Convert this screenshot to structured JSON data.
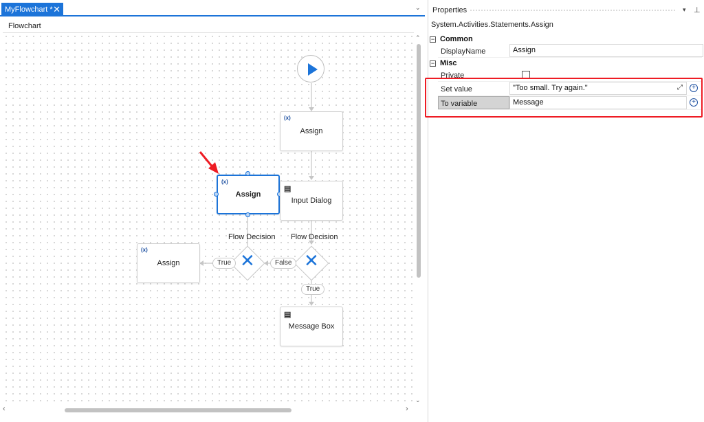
{
  "tab": {
    "title": "MyFlowchart *",
    "close": "✕",
    "dropdown": "⌄"
  },
  "breadcrumb": "Flowchart",
  "flowchart": {
    "assign_top": "Assign",
    "assign_selected": "Assign",
    "assign_left": "Assign",
    "input_dialog": "Input Dialog",
    "message_box": "Message Box",
    "decision_left": "Flow Decision",
    "decision_right": "Flow Decision",
    "pill_true_left": "True",
    "pill_false": "False",
    "pill_true_bottom": "True",
    "assign_icon": "(x)",
    "dialog_icon": "▤"
  },
  "properties": {
    "title": "Properties",
    "type": "System.Activities.Statements.Assign",
    "categories": {
      "common": "Common",
      "misc": "Misc",
      "collapse_glyph": "−"
    },
    "rows": {
      "display_name": {
        "label": "DisplayName",
        "value": "Assign"
      },
      "private": {
        "label": "Private",
        "checked": false
      },
      "set_value": {
        "label": "Set value",
        "value": "\"Too small. Try again.\""
      },
      "to_variable": {
        "label": "To variable",
        "value": "Message"
      }
    },
    "plus_glyph": "+",
    "pin_glyph": "⊥",
    "drop_glyph": "▾"
  },
  "colors": {
    "accent": "#1c74d9",
    "highlight": "#ee1c24",
    "arrow": "#ee1c24"
  }
}
